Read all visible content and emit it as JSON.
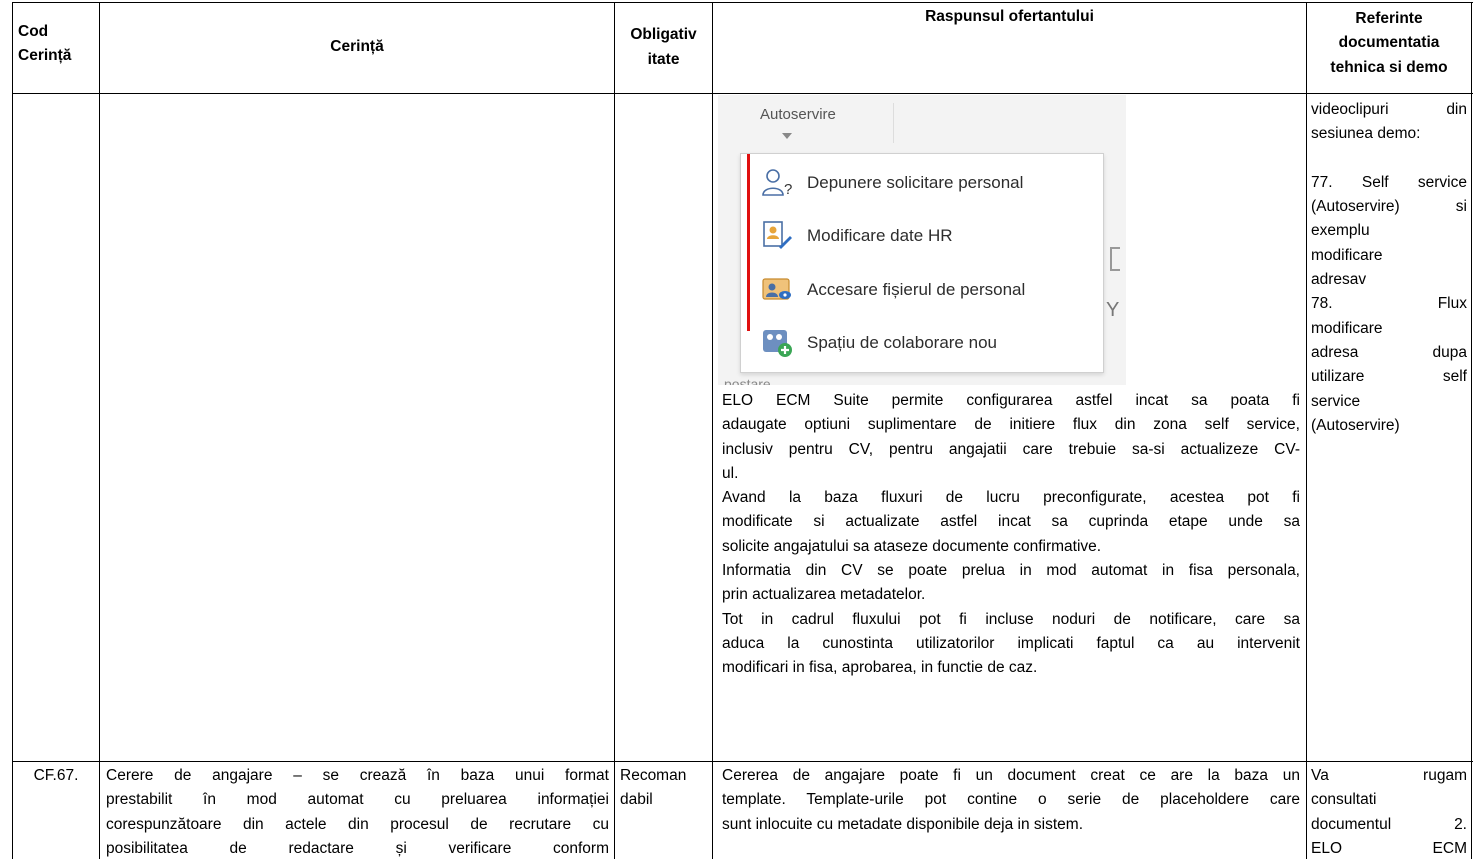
{
  "header": {
    "cod_line1": "Cod",
    "cod_line2": "Cerință",
    "cerinta": "Cerință",
    "oblig_line1": "Obligativ",
    "oblig_line2": "itate",
    "raspuns": "Raspunsul ofertantului",
    "ref_line1": "Referinte",
    "ref_line2": "documentatia",
    "ref_line3": "tehnica si demo"
  },
  "row1": {
    "screenshot": {
      "tab": "Autoservire",
      "menu_items": [
        {
          "label": "Depunere solicitare personal",
          "icon": "person-question-icon"
        },
        {
          "label": "Modificare date HR",
          "icon": "edit-document-icon"
        },
        {
          "label": "Accesare fișierul de personal",
          "icon": "personnel-file-icon"
        },
        {
          "label": "Spațiu de colaborare nou",
          "icon": "collaboration-space-icon"
        }
      ],
      "right_glyph_2": "Y",
      "bottom_text": "postare"
    },
    "response_lines": [
      "ELO ECM Suite permite configurarea astfel incat sa poata fi",
      "adaugate optiuni suplimentare de initiere flux din zona self service,",
      "inclusiv pentru CV, pentru angajatii care trebuie sa-si actualizeze CV-",
      "ul.",
      "Avand la baza fluxuri de lucru preconfigurate, acestea pot fi",
      "modificate si actualizate astfel incat sa cuprinda etape unde sa",
      "solicite angajatului sa ataseze documente confirmative.",
      "Informatia din CV se poate prelua in mod automat in fisa personala,",
      "prin actualizarea metadatelor.",
      "Tot in cadrul fluxului pot fi incluse noduri de notificare, care sa",
      "aduca la cunostinta utilizatorilor implicati faptul ca au intervenit",
      "modificari in fisa, aprobarea, in functie de caz."
    ],
    "reference_lines": [
      "videoclipuri din",
      "sesiunea demo:",
      "",
      "77. Self service",
      "(Autoservire) si",
      "exemplu",
      "modificare",
      "adresav",
      "78. Flux",
      "modificare",
      "adresa dupa",
      "utilizare self",
      "service",
      "(Autoservire)"
    ]
  },
  "row2": {
    "code": "CF.67.",
    "requirement_lines": [
      "Cerere de angajare – se crează în baza unui format",
      "prestabilit în mod automat cu preluarea informației",
      "corespunzătoare din actele din procesul de recrutare cu",
      "posibilitatea de redactare și verificare conform"
    ],
    "oblig_lines": [
      "Recoman",
      "dabil"
    ],
    "response_lines": [
      "Cererea de angajare poate fi un document creat ce are la baza un",
      "template. Template-urile pot contine o serie de placeholdere care",
      "sunt inlocuite cu metadate disponibile deja in sistem."
    ],
    "reference_lines": [
      "Va rugam",
      "consultati",
      "documentul 2.",
      "ELO ECM"
    ]
  }
}
